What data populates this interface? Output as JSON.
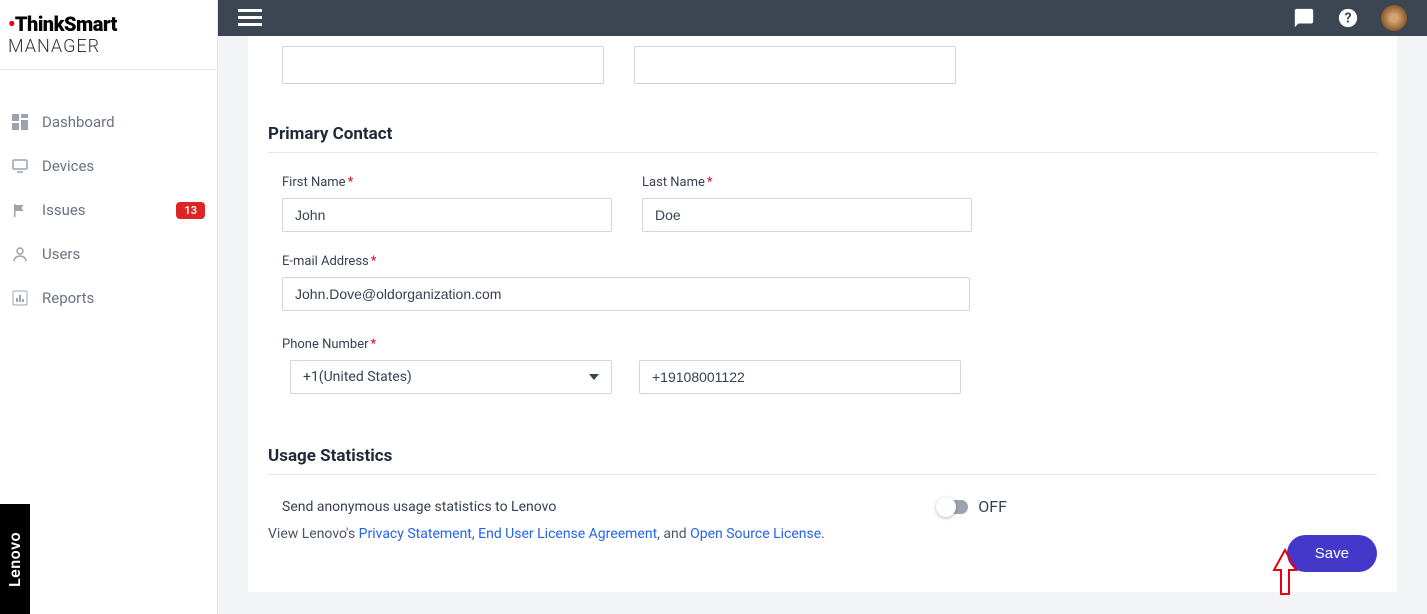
{
  "brand": {
    "logo_main": "ThinkSmart",
    "logo_sub": "MANAGER",
    "lenovo": "Lenovo"
  },
  "sidebar": {
    "items": [
      {
        "label": "Dashboard"
      },
      {
        "label": "Devices"
      },
      {
        "label": "Issues",
        "badge": "13"
      },
      {
        "label": "Users"
      },
      {
        "label": "Reports"
      }
    ]
  },
  "sections": {
    "primary_contact_title": "Primary Contact",
    "usage_title": "Usage Statistics"
  },
  "form": {
    "first_name_label": "First Name",
    "first_name_value": "John",
    "last_name_label": "Last Name",
    "last_name_value": "Doe",
    "email_label": "E-mail Address",
    "email_value": "John.Dove@oldorganization.com",
    "phone_label": "Phone Number",
    "country_code": "+1(United States)",
    "phone_value": "+19108001122"
  },
  "usage": {
    "send_text": "Send anonymous usage statistics to Lenovo",
    "toggle_label": "OFF",
    "view_prefix": "View Lenovo's ",
    "privacy": "Privacy Statement",
    "sep1": ", ",
    "eula": "End User License Agreement",
    "sep2": ", and ",
    "osl": "Open Source License",
    "suffix": "."
  },
  "buttons": {
    "save": "Save"
  },
  "required": "*"
}
